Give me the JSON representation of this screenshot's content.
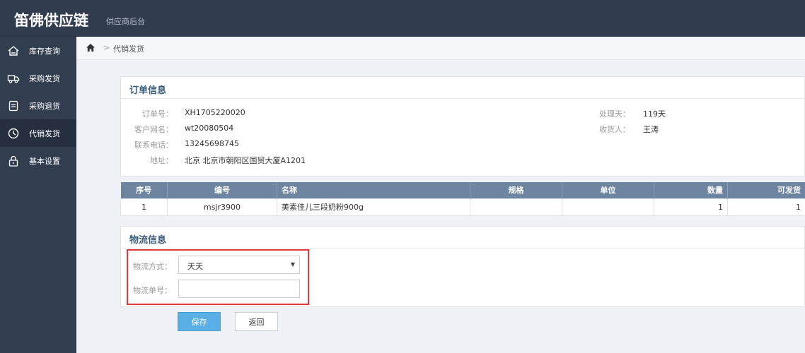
{
  "header": {
    "brand": "笛佛供应链",
    "subtitle": "供应商后台"
  },
  "sidebar": {
    "items": [
      {
        "label": "库存查询",
        "icon": "home-box-icon",
        "active": false
      },
      {
        "label": "采购发货",
        "icon": "truck-icon",
        "active": false
      },
      {
        "label": "采购退货",
        "icon": "document-icon",
        "active": false
      },
      {
        "label": "代销发货",
        "icon": "clock-icon",
        "active": true
      },
      {
        "label": "基本设置",
        "icon": "lock-icon",
        "active": false
      }
    ]
  },
  "breadcrumb": {
    "separator": ">",
    "current": "代销发货"
  },
  "order": {
    "title": "订单信息",
    "fields": [
      {
        "label": "订单号：",
        "value": "XH1705220020"
      },
      {
        "label": "客户网名：",
        "value": "wt20080504"
      },
      {
        "label": "联系电话：",
        "value": "13245698745"
      },
      {
        "label": "地址：",
        "value": "北京 北京市朝阳区国贸大厦A1201"
      }
    ],
    "right_fields": [
      {
        "label": "处理天：",
        "value": "119天"
      },
      {
        "label": "收货人：",
        "value": "王涛"
      }
    ]
  },
  "items_table": {
    "headers": [
      "序号",
      "编号",
      "名称",
      "规格",
      "单位",
      "数量",
      "可发货"
    ],
    "rows": [
      [
        "1",
        "msjr3900",
        "美素佳儿三段奶粉900g",
        "",
        "",
        "1",
        "1"
      ]
    ]
  },
  "logistics": {
    "title": "物流信息",
    "method_label": "物流方式：",
    "method_value": "天天",
    "tracking_label": "物流单号：",
    "tracking_value": "",
    "tracking_placeholder": ""
  },
  "actions": {
    "save": "保存",
    "back": "返回"
  },
  "colors": {
    "topbar": "#323c4f",
    "sidebar": "#333d50",
    "table_header": "#6d85a1",
    "save_button": "#5aaee6",
    "highlight_box": "#e03a3a"
  }
}
